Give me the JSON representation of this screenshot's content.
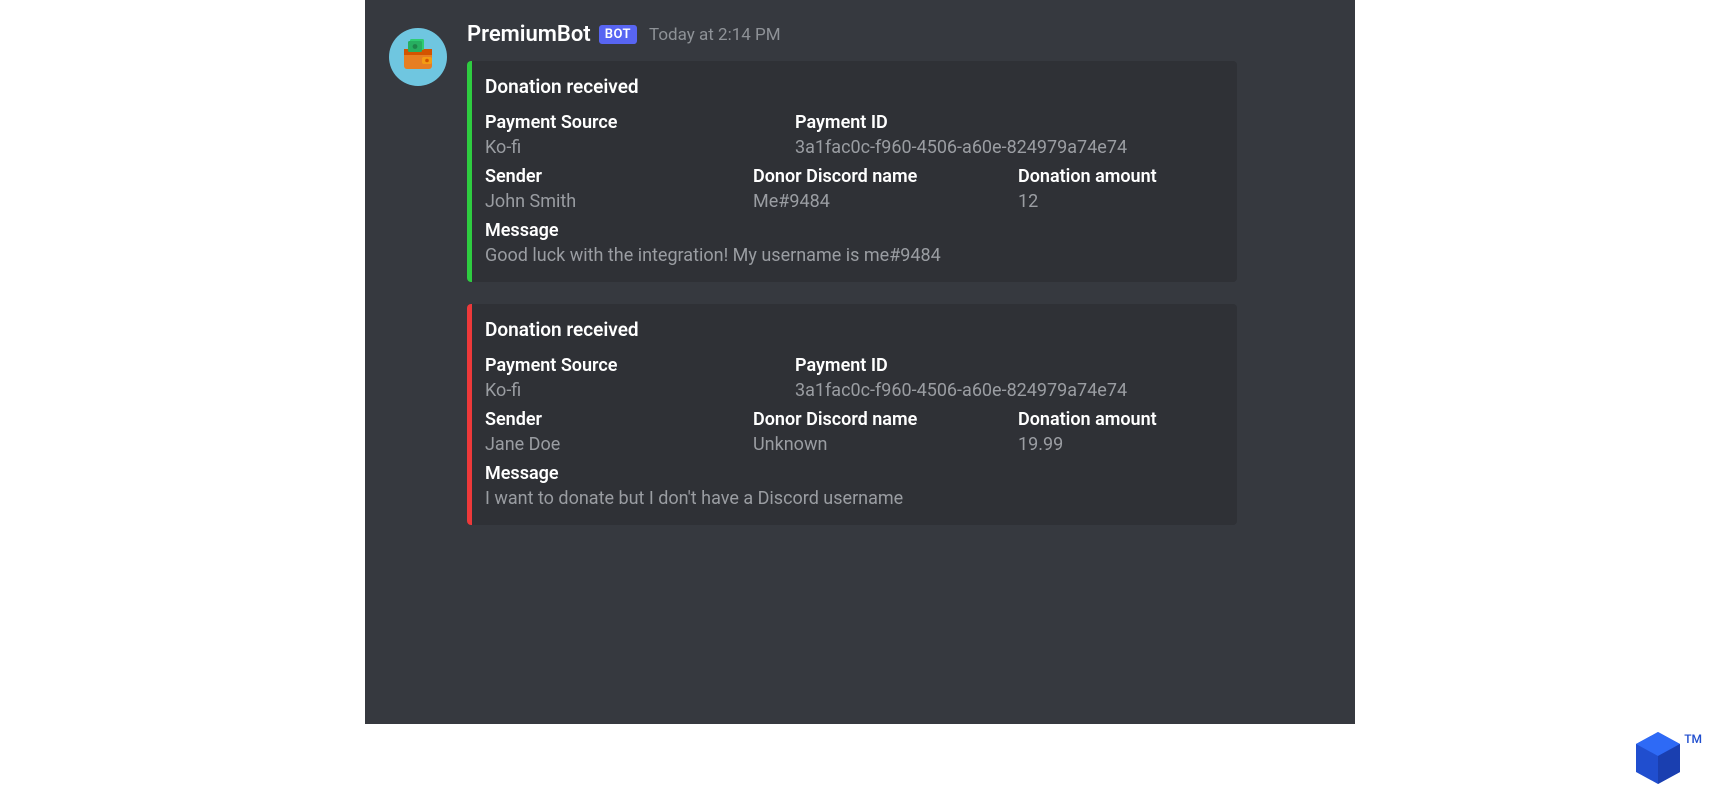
{
  "author": "PremiumBot",
  "bot_badge": "BOT",
  "timestamp": "Today at 2:14 PM",
  "colors": {
    "accent_green": "#2ecc40",
    "accent_red": "#ed393a",
    "bot_badge_bg": "#5865f2"
  },
  "icon_name": "wallet-icon",
  "embeds": [
    {
      "stripe": "green",
      "title": "Donation received",
      "row1": {
        "payment_source_label": "Payment Source",
        "payment_source_value": "Ko-fi",
        "payment_id_label": "Payment ID",
        "payment_id_value": "3a1fac0c-f960-4506-a60e-824979a74e74"
      },
      "row2": {
        "sender_label": "Sender",
        "sender_value": "John Smith",
        "donor_label": "Donor Discord name",
        "donor_value": "Me#9484",
        "amount_label": "Donation amount",
        "amount_value": "12"
      },
      "message_label": "Message",
      "message_value": "Good luck with the integration! My username is me#9484"
    },
    {
      "stripe": "red",
      "title": "Donation received",
      "row1": {
        "payment_source_label": "Payment Source",
        "payment_source_value": "Ko-fi",
        "payment_id_label": "Payment ID",
        "payment_id_value": "3a1fac0c-f960-4506-a60e-824979a74e74"
      },
      "row2": {
        "sender_label": "Sender",
        "sender_value": "Jane Doe",
        "donor_label": "Donor Discord name",
        "donor_value": "Unknown",
        "amount_label": "Donation amount",
        "amount_value": "19.99"
      },
      "message_label": "Message",
      "message_value": "I want to donate but I don't have a Discord username"
    }
  ],
  "trademark": "TM"
}
